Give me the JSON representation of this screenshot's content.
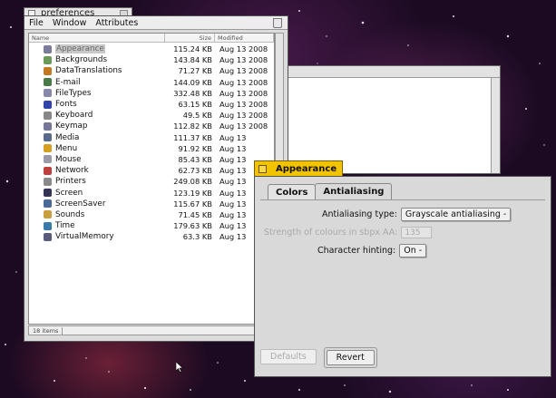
{
  "prefs_window": {
    "title": "preferences",
    "menu": [
      "File",
      "Window",
      "Attributes"
    ],
    "columns": {
      "name": "Name",
      "size": "Size",
      "modified": "Modified"
    },
    "rows": [
      {
        "name": "Appearance",
        "size": "115.24 KB",
        "modified": "Aug 13 2008",
        "icon": "appearance-icon",
        "color": "#7a7a9a",
        "selected": true
      },
      {
        "name": "Backgrounds",
        "size": "143.84 KB",
        "modified": "Aug 13 2008",
        "icon": "backgrounds-icon",
        "color": "#6a9a5a"
      },
      {
        "name": "DataTranslations",
        "size": "71.27 KB",
        "modified": "Aug 13 2008",
        "icon": "datatranslations-icon",
        "color": "#c27a22"
      },
      {
        "name": "E-mail",
        "size": "144.09 KB",
        "modified": "Aug 13 2008",
        "icon": "email-icon",
        "color": "#4a7a4a"
      },
      {
        "name": "FileTypes",
        "size": "332.48 KB",
        "modified": "Aug 13 2008",
        "icon": "filetypes-icon",
        "color": "#8888aa"
      },
      {
        "name": "Fonts",
        "size": "63.15 KB",
        "modified": "Aug 13 2008",
        "icon": "fonts-icon",
        "color": "#3344aa"
      },
      {
        "name": "Keyboard",
        "size": "49.5 KB",
        "modified": "Aug 13 2008",
        "icon": "keyboard-icon",
        "color": "#888888"
      },
      {
        "name": "Keymap",
        "size": "112.82 KB",
        "modified": "Aug 13 2008",
        "icon": "keymap-icon",
        "color": "#777799"
      },
      {
        "name": "Media",
        "size": "111.37 KB",
        "modified": "Aug 13",
        "icon": "media-icon",
        "color": "#5a6a8a"
      },
      {
        "name": "Menu",
        "size": "91.92 KB",
        "modified": "Aug 13",
        "icon": "menu-icon",
        "color": "#d8a020"
      },
      {
        "name": "Mouse",
        "size": "85.43 KB",
        "modified": "Aug 13",
        "icon": "mouse-icon",
        "color": "#9a9aaa"
      },
      {
        "name": "Network",
        "size": "62.73 KB",
        "modified": "Aug 13",
        "icon": "network-icon",
        "color": "#c04040"
      },
      {
        "name": "Printers",
        "size": "249.08 KB",
        "modified": "Aug 13",
        "icon": "printers-icon",
        "color": "#8a8a8a"
      },
      {
        "name": "Screen",
        "size": "123.19 KB",
        "modified": "Aug 13",
        "icon": "screen-icon",
        "color": "#333355"
      },
      {
        "name": "ScreenSaver",
        "size": "115.67 KB",
        "modified": "Aug 13",
        "icon": "screensaver-icon",
        "color": "#4a6a9a"
      },
      {
        "name": "Sounds",
        "size": "71.45 KB",
        "modified": "Aug 13",
        "icon": "sounds-icon",
        "color": "#c8a040"
      },
      {
        "name": "Time",
        "size": "179.63 KB",
        "modified": "Aug 13",
        "icon": "time-icon",
        "color": "#3a7aaa"
      },
      {
        "name": "VirtualMemory",
        "size": "63.3 KB",
        "modified": "Aug 13",
        "icon": "virtualmemory-icon",
        "color": "#5a5a7a"
      }
    ],
    "status_count": "18 items"
  },
  "appearance_window": {
    "title": "Appearance",
    "title_color": "#f2c400",
    "tabs": [
      "Colors",
      "Antialiasing"
    ],
    "active_tab": "Antialiasing",
    "antialiasing_type_label": "Antialiasing type:",
    "antialiasing_type_value": "Grayscale antialiasing",
    "strength_label": "Strength of colours in sbpx AA:",
    "strength_value": "135",
    "hinting_label": "Character hinting:",
    "hinting_value": "On",
    "defaults_label": "Defaults",
    "revert_label": "Revert"
  }
}
